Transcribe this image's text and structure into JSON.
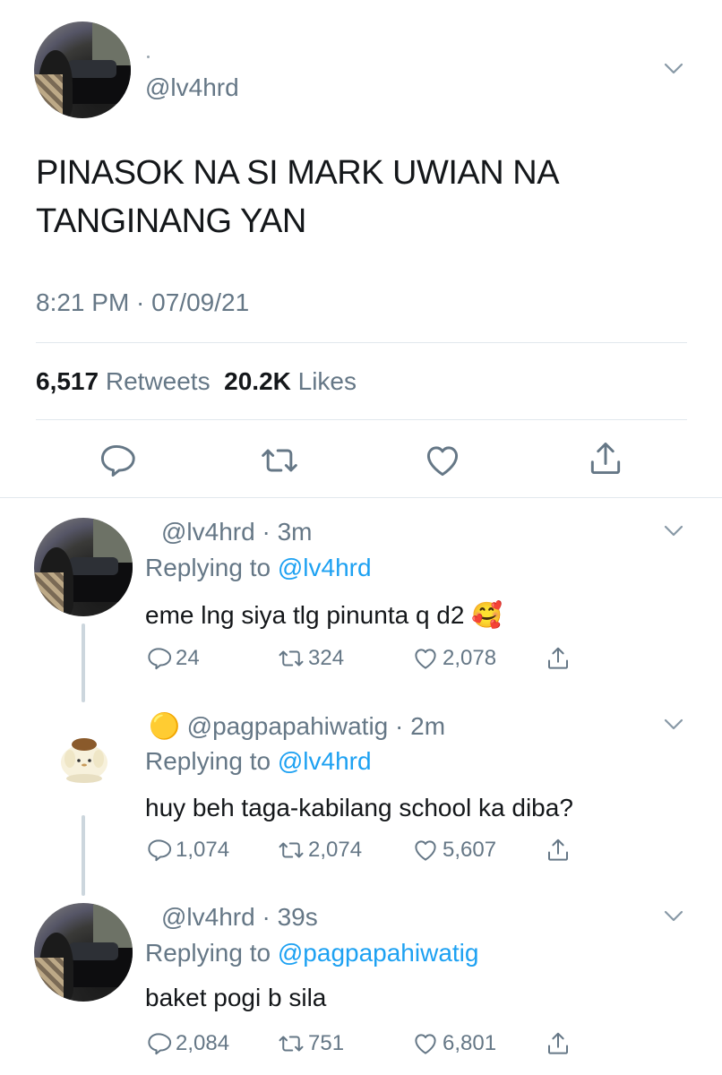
{
  "tweet": {
    "handle": "@lv4hrd",
    "text_line1": "PINASOK NA SI MARK UWIAN NA",
    "text_line2": "TANGINANG YAN",
    "time": "8:21 PM · 07/09/21",
    "retweets_count": "6,517",
    "retweets_label": "Retweets",
    "likes_count": "20.2K",
    "likes_label": "Likes"
  },
  "replies": [
    {
      "handle": "@lv4hrd",
      "age": "3m",
      "replying_label": "Replying to",
      "replying_to": "@lv4hrd",
      "text": "eme lng siya tlg pinunta q d2",
      "emoji": "🥰",
      "reply_count": "24",
      "retweet_count": "324",
      "like_count": "2,078"
    },
    {
      "name_emoji": "🟡",
      "handle": "@pagpapahiwatig",
      "age": "2m",
      "replying_label": "Replying to",
      "replying_to": "@lv4hrd",
      "text": "huy beh taga-kabilang school ka diba?",
      "reply_count": "1,074",
      "retweet_count": "2,074",
      "like_count": "5,607"
    },
    {
      "handle": "@lv4hrd",
      "age": "39s",
      "replying_label": "Replying to",
      "replying_to": "@pagpapahiwatig",
      "text": "baket pogi b sila",
      "reply_count": "2,084",
      "retweet_count": "751",
      "like_count": "6,801"
    }
  ],
  "colors": {
    "accent": "#1da1f2",
    "muted": "#657786",
    "text": "#14171a",
    "divider": "#e1e8ed"
  },
  "icons": [
    "reply-icon",
    "retweet-icon",
    "like-icon",
    "share-icon",
    "chevron-down-icon"
  ]
}
